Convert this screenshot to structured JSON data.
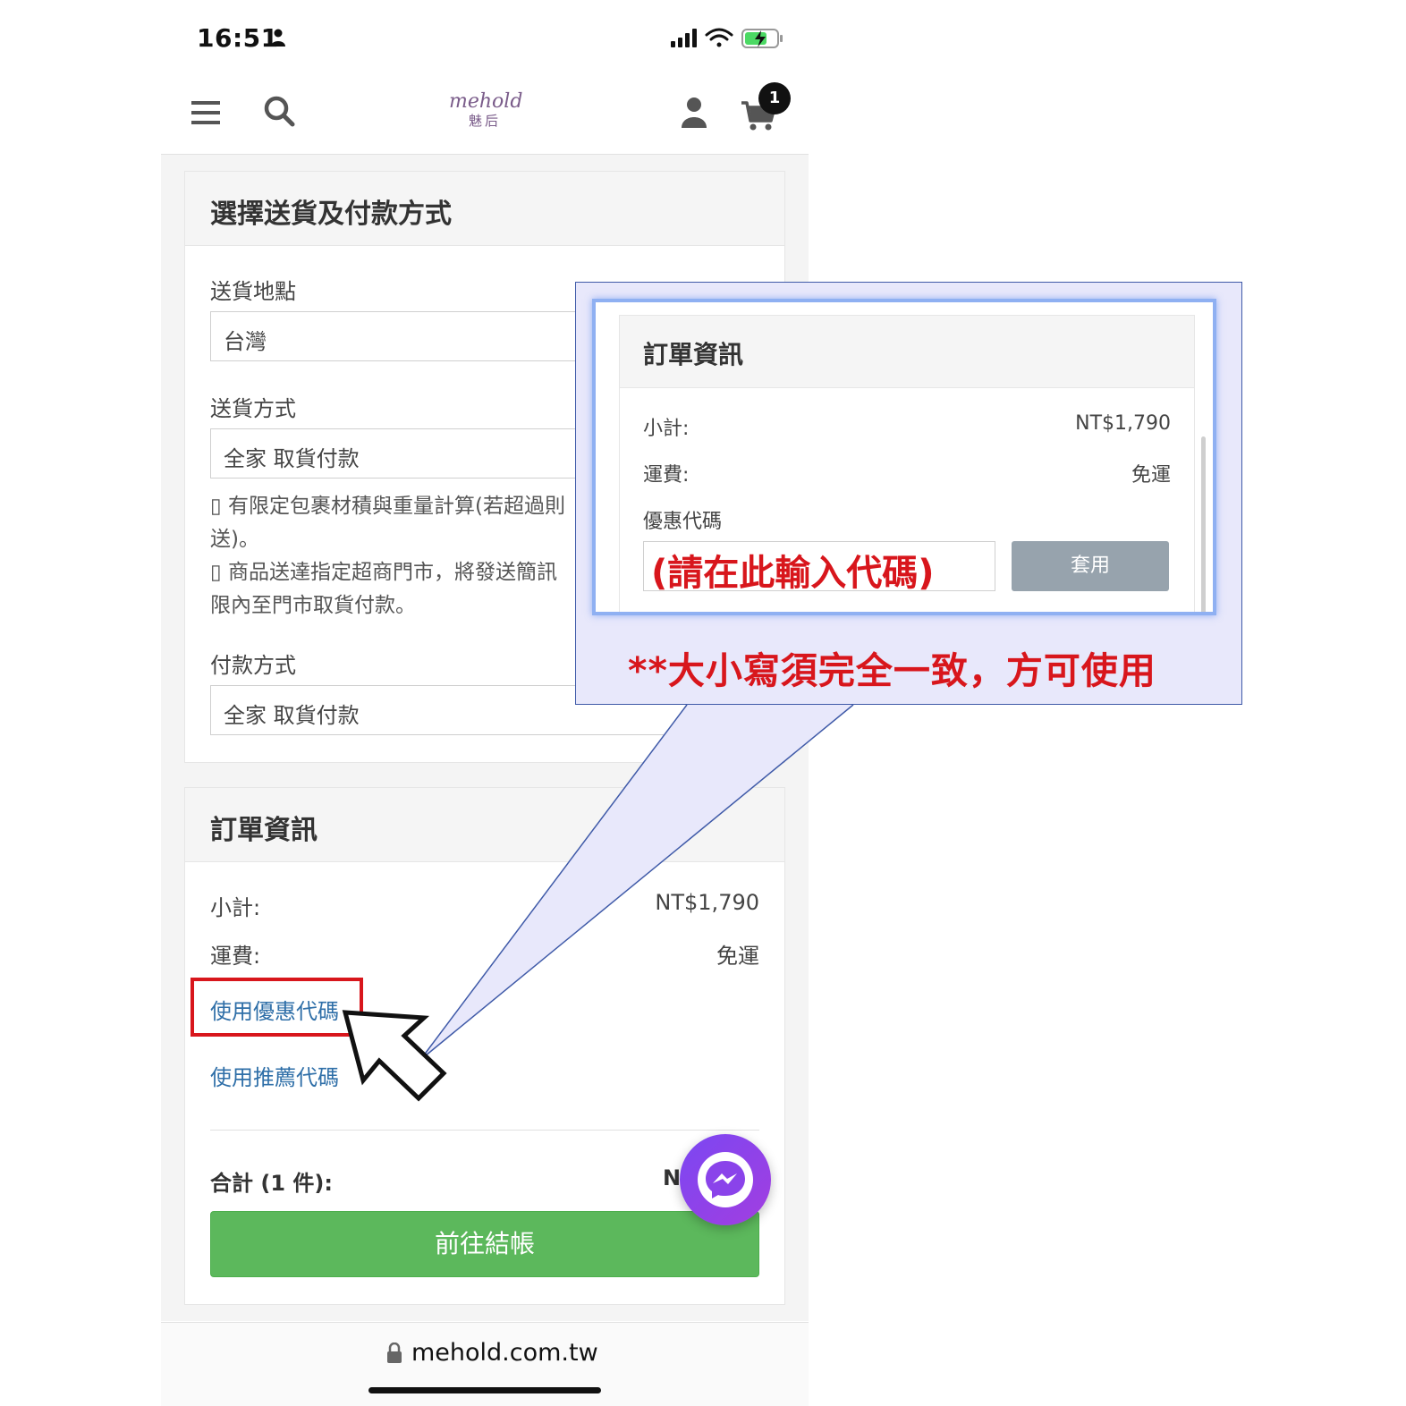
{
  "status_bar": {
    "time": "16:51"
  },
  "header": {
    "logo_text": "mehold",
    "logo_subtext": "魅后",
    "cart_count": "1"
  },
  "shipping_section": {
    "title": "選擇送貨及付款方式",
    "location_label": "送貨地點",
    "location_value": "台灣",
    "method_label": "送貨方式",
    "method_value": "全家 取貨付款",
    "note_lines": [
      "▯ 有限定包裹材積與重量計算(若超過則",
      "送)。",
      "▯ 商品送達指定超商門市，將發送簡訊",
      "限內至門市取貨付款。"
    ],
    "payment_label": "付款方式",
    "payment_value": "全家 取貨付款"
  },
  "order_section": {
    "title": "訂單資訊",
    "subtotal_label": "小計:",
    "subtotal_value": "NT$1,790",
    "shipping_fee_label": "運費:",
    "shipping_fee_value": "免運",
    "coupon_link": "使用優惠代碼",
    "referral_link": "使用推薦代碼",
    "total_label": "合計 (1 件):",
    "total_value_partial": "N",
    "checkout_button": "前往結帳"
  },
  "callout": {
    "title": "訂單資訊",
    "subtotal_label": "小計:",
    "subtotal_value": "NT$1,790",
    "shipping_fee_label": "運費:",
    "shipping_fee_value": "免運",
    "coupon_label": "優惠代碼",
    "coupon_input_hint": "(請在此輸入代碼)",
    "apply_button": "套用",
    "note": "**大小寫須完全一致，方可使用"
  },
  "browser": {
    "url": "mehold.com.tw"
  },
  "colors": {
    "link": "#2f6fa8",
    "checkout_green": "#5cb85c",
    "highlight_red": "#d8161c",
    "callout_bg": "#e8e8fb",
    "messenger_purple": "#8a43ea"
  },
  "icons": [
    "menu-icon",
    "search-icon",
    "user-icon",
    "cart-icon",
    "lock-icon",
    "messenger-icon",
    "signal-icon",
    "wifi-icon",
    "battery-icon",
    "person-icon",
    "pointer-arrow-icon"
  ]
}
